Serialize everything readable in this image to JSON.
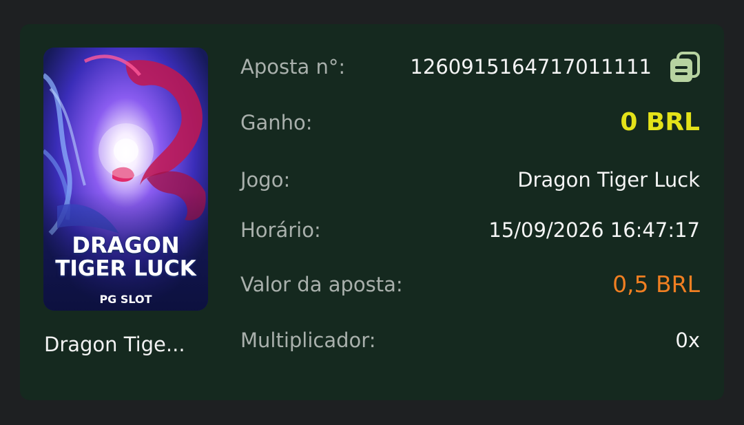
{
  "bet_detail": {
    "game_thumbnail": {
      "title_line1": "DRAGON",
      "title_line2": "TIGER LUCK",
      "brand": "PG SLOT"
    },
    "game_name": "Dragon Tige...",
    "rows": {
      "bet_id": {
        "label": "Aposta n°:",
        "value": "1260915164717011111"
      },
      "win": {
        "label": "Ganho:",
        "value": "0 BRL"
      },
      "game": {
        "label": "Jogo:",
        "value": "Dragon Tiger Luck"
      },
      "time": {
        "label": "Horário:",
        "value": "15/09/2026 16:47:17"
      },
      "bet_amount": {
        "label": "Valor da aposta:",
        "value": "0,5 BRL"
      },
      "multiplier": {
        "label": "Multiplicador:",
        "value": "0x"
      }
    },
    "copy_icon": "copy-icon"
  },
  "colors": {
    "background": "#1e2022",
    "card": "#15291f",
    "label": "#a9b0ac",
    "value": "#f4f4f4",
    "win": "#e4e219",
    "bet_amount": "#f07f22",
    "copy_icon": "#b7d3a1"
  }
}
